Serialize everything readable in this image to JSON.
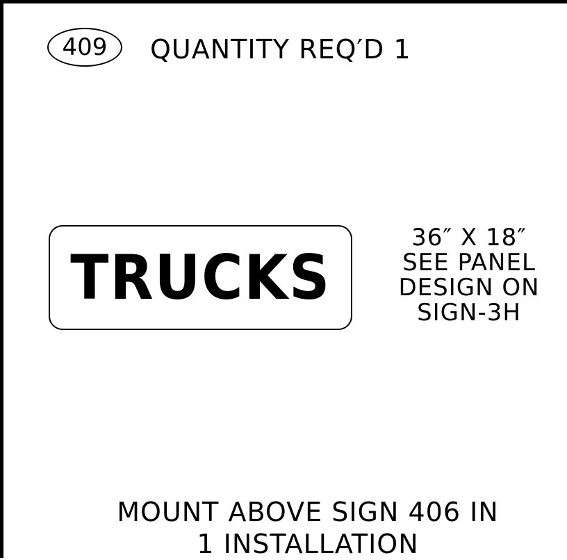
{
  "sign_number": "409",
  "quantity_text": "QUANTITY REQ′D 1",
  "panel": {
    "legend": "TRUCKS"
  },
  "notes": {
    "size": "36″ X 18″",
    "line2": "SEE PANEL",
    "line3": "DESIGN ON",
    "line4": "SIGN-3H"
  },
  "mounting": {
    "line1": "MOUNT ABOVE SIGN 406 IN",
    "line2": "1 INSTALLATION"
  }
}
